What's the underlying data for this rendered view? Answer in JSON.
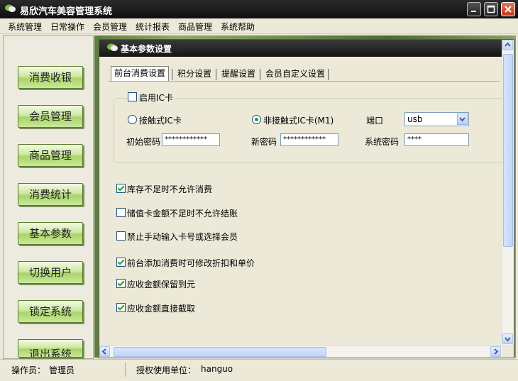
{
  "window": {
    "title": "易欣汽车美容管理系统"
  },
  "menu": [
    "系统管理",
    "日常操作",
    "会员管理",
    "统计报表",
    "商品管理",
    "系统帮助"
  ],
  "sidebar": {
    "buttons": [
      "消费收银",
      "会员管理",
      "商品管理",
      "消费统计",
      "基本参数",
      "切换用户",
      "锁定系统",
      "退出系统"
    ]
  },
  "dialog": {
    "title": "基本参数设置",
    "tabs": [
      "前台消费设置",
      "积分设置",
      "提醒设置",
      "会员自定义设置"
    ],
    "ic_card": {
      "enable_label": "启用IC卡",
      "contact_label": "接触式IC卡",
      "contactless_label": "非接触式IC卡(M1)",
      "port_label": "端口",
      "port_value": "usb",
      "initial_password_label": "初始密码",
      "initial_password_value": "************",
      "new_password_label": "新密码",
      "new_password_value": "************",
      "system_password_label": "系统密码",
      "system_password_value": "****"
    },
    "options": [
      {
        "label": "库存不足时不允许消费",
        "checked": true
      },
      {
        "label": "储值卡金额不足时不允许结账",
        "checked": false
      },
      {
        "label": "禁止手动输入卡号或选择会员",
        "checked": false
      },
      {
        "label": "前台添加消费时可修改折扣和单价",
        "checked": true
      },
      {
        "label": "应收金额保留到元",
        "checked": true
      },
      {
        "label": "应收金额直接截取",
        "checked": true
      }
    ]
  },
  "status": {
    "operator_label": "操作员：",
    "operator_value": "管理员",
    "license_label": "授权使用单位：",
    "license_value": "hanguo"
  },
  "colors": {
    "accent_green": "#21a121",
    "title_bar": "#1a1a1a"
  }
}
